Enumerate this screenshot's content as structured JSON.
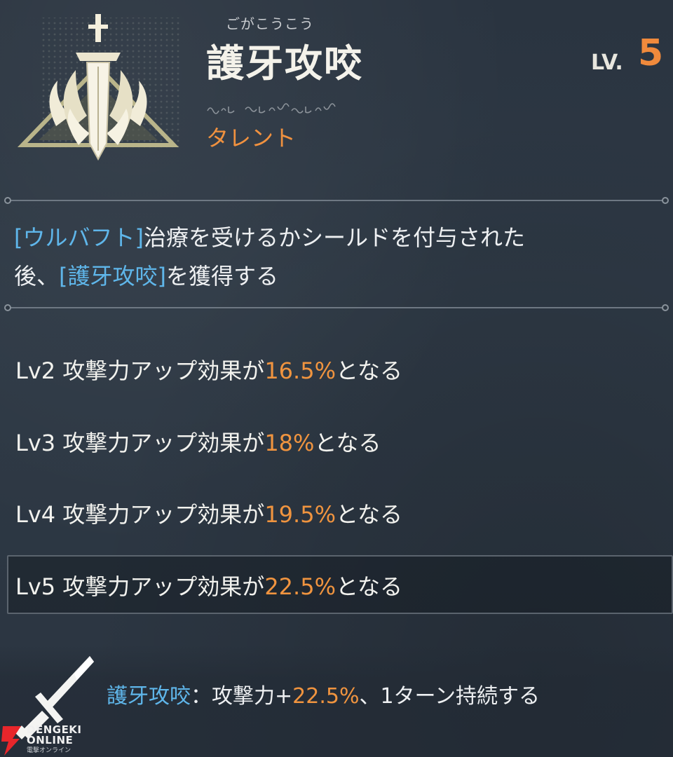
{
  "skill": {
    "ruby": "ごがこうこう",
    "name": "護牙攻咬",
    "level_label": "LV.",
    "level_value": "5",
    "category": "タレント",
    "icon": "sword-claw-emblem-icon"
  },
  "description": {
    "line1_kw": "[ウルバフト]",
    "line1_rest": "治療を受けるかシールドを付与された",
    "line2_pre": "後、",
    "line2_kw": "[護牙攻咬]",
    "line2_rest": "を獲得する"
  },
  "levels": [
    {
      "label": "Lv2 攻撃力アップ効果が",
      "value": "16.5%",
      "suffix": "となる"
    },
    {
      "label": "Lv3 攻撃力アップ効果が",
      "value": "18%",
      "suffix": "となる"
    },
    {
      "label": "Lv4 攻撃力アップ効果が",
      "value": "19.5%",
      "suffix": "となる"
    },
    {
      "label": "Lv5 攻撃力アップ効果が",
      "value": "22.5%",
      "suffix": "となる",
      "current": true
    }
  ],
  "effect": {
    "name": "護牙攻咬",
    "separator": "：攻撃力+",
    "value": "22.5%",
    "suffix": "、1ターン持続する",
    "icon": "sword-icon"
  },
  "watermark": {
    "line1": "DENGEKI",
    "line2": "ONLINE",
    "line3": "電撃オンライン"
  },
  "colors": {
    "accent_orange": "#f08a3c",
    "keyword_blue": "#5fb6ea",
    "background": "#2c3641"
  }
}
